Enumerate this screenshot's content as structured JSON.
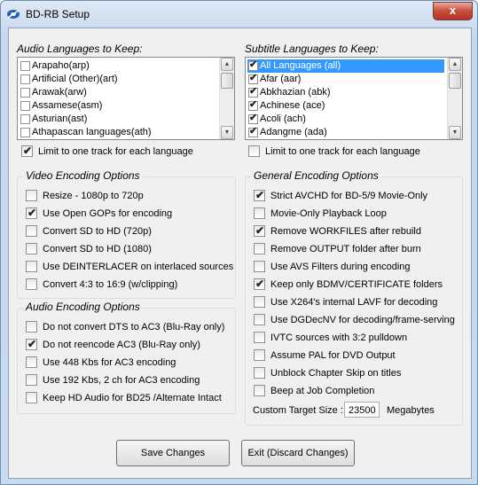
{
  "window": {
    "title": "BD-RB Setup",
    "close_glyph": "x"
  },
  "audio_languages": {
    "label": "Audio Languages to Keep:",
    "items": [
      {
        "label": "Arapaho(arp)",
        "checked": false
      },
      {
        "label": "Artificial (Other)(art)",
        "checked": false
      },
      {
        "label": "Arawak(arw)",
        "checked": false
      },
      {
        "label": "Assamese(asm)",
        "checked": false
      },
      {
        "label": "Asturian(ast)",
        "checked": false
      },
      {
        "label": "Athapascan languages(ath)",
        "checked": false
      }
    ],
    "limit_label": "Limit to one track for each language",
    "limit_checked": true
  },
  "subtitle_languages": {
    "label": "Subtitle Languages to Keep:",
    "items": [
      {
        "label": "All Languages (all)",
        "checked": true,
        "selected": true
      },
      {
        "label": "Afar (aar)",
        "checked": true
      },
      {
        "label": "Abkhazian (abk)",
        "checked": true
      },
      {
        "label": "Achinese (ace)",
        "checked": true
      },
      {
        "label": "Acoli (ach)",
        "checked": true
      },
      {
        "label": "Adangme (ada)",
        "checked": true
      }
    ],
    "limit_label": "Limit to one track for each language",
    "limit_checked": false
  },
  "video_encoding": {
    "title": "Video Encoding Options",
    "options": [
      {
        "label": "Resize  - 1080p to 720p",
        "checked": false
      },
      {
        "label": "Use Open GOPs for encoding",
        "checked": true
      },
      {
        "label": "Convert SD to HD (720p)",
        "checked": false
      },
      {
        "label": "Convert SD to HD (1080)",
        "checked": false
      },
      {
        "label": "Use DEINTERLACER on interlaced sources",
        "checked": false
      },
      {
        "label": "Convert 4:3 to 16:9 (w/clipping)",
        "checked": false
      }
    ]
  },
  "audio_encoding": {
    "title": "Audio Encoding Options",
    "options": [
      {
        "label": "Do not convert DTS to AC3  (Blu-Ray only)",
        "checked": false
      },
      {
        "label": "Do not reencode AC3  (Blu-Ray only)",
        "checked": true
      },
      {
        "label": "Use 448 Kbs for AC3 encoding",
        "checked": false
      },
      {
        "label": "Use 192 Kbs, 2 ch for AC3 encoding",
        "checked": false
      },
      {
        "label": "Keep HD Audio for BD25 /Alternate Intact",
        "checked": false
      }
    ]
  },
  "general_encoding": {
    "title": "General Encoding Options",
    "options": [
      {
        "label": "Strict AVCHD for BD-5/9 Movie-Only",
        "checked": true
      },
      {
        "label": "Movie-Only Playback Loop",
        "checked": false
      },
      {
        "label": "Remove WORKFILES after rebuild",
        "checked": true
      },
      {
        "label": "Remove OUTPUT folder after burn",
        "checked": false
      },
      {
        "label": "Use AVS Filters during encoding",
        "checked": false
      },
      {
        "label": "Keep only BDMV/CERTIFICATE folders",
        "checked": true
      },
      {
        "label": "Use X264's internal LAVF for decoding",
        "checked": false
      },
      {
        "label": "Use DGDecNV for decoding/frame-serving",
        "checked": false
      },
      {
        "label": "IVTC sources with 3:2 pulldown",
        "checked": false
      },
      {
        "label": "Assume PAL for DVD Output",
        "checked": false
      },
      {
        "label": "Unblock Chapter Skip on titles",
        "checked": false
      },
      {
        "label": "Beep at Job Completion",
        "checked": false
      }
    ],
    "custom_size_label": "Custom Target Size :",
    "custom_size_value": "23500",
    "custom_size_unit": "Megabytes"
  },
  "buttons": {
    "save": "Save Changes",
    "exit": "Exit (Discard Changes)"
  },
  "icons": {
    "app": "bd-rb-app-icon",
    "check": "checkmark-icon",
    "close": "close-icon",
    "scroll_up": "scroll-up-arrow-icon",
    "scroll_down": "scroll-down-arrow-icon"
  },
  "colors": {
    "selection": "#3399ff",
    "close_button": "#c74c3c",
    "frame": "#c9daee"
  }
}
